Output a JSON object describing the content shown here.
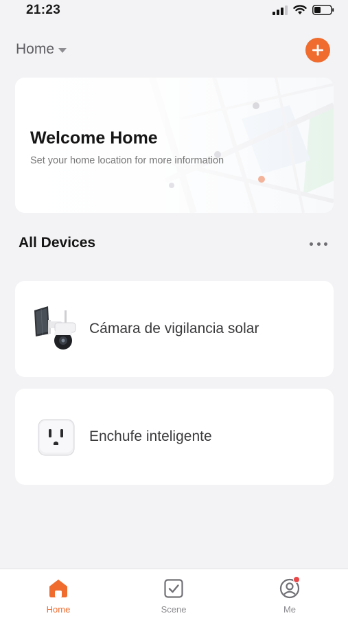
{
  "status_bar": {
    "time": "21:23"
  },
  "header": {
    "home_label": "Home"
  },
  "welcome": {
    "title": "Welcome Home",
    "subtitle": "Set your home location for more information"
  },
  "section": {
    "title": "All Devices"
  },
  "devices": [
    {
      "name": "Cámara de vigilancia solar",
      "icon": "solar-camera-icon"
    },
    {
      "name": "Enchufe inteligente",
      "icon": "smart-plug-icon"
    }
  ],
  "tabs": [
    {
      "label": "Home",
      "icon": "home-icon",
      "active": true
    },
    {
      "label": "Scene",
      "icon": "scene-check-icon",
      "active": false
    },
    {
      "label": "Me",
      "icon": "profile-icon",
      "active": false
    }
  ],
  "colors": {
    "accent": "#ef6c2e",
    "background": "#f3f3f5",
    "card": "#ffffff",
    "badge": "#e94747"
  }
}
